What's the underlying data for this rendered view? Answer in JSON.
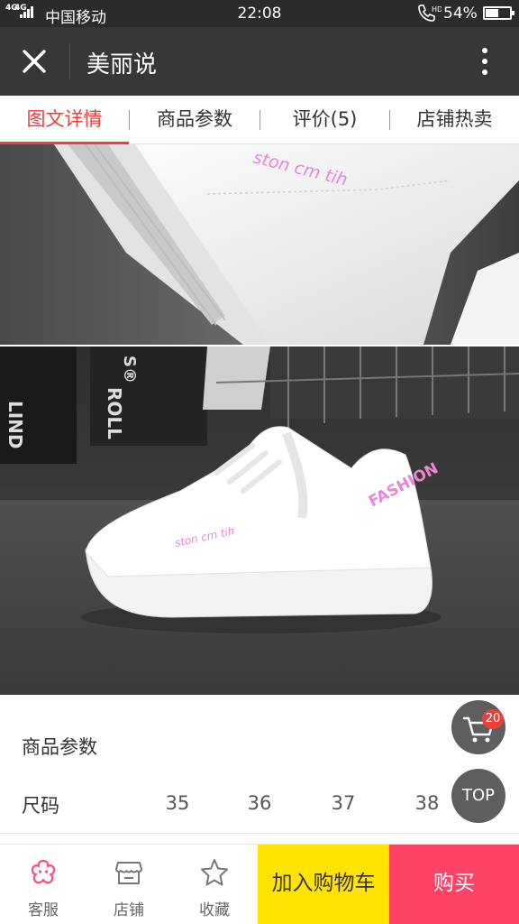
{
  "status_bar": {
    "network": "4G",
    "network2": "4G",
    "carrier": "中国移动",
    "time": "22:08",
    "hd": "HD",
    "battery": "54%",
    "battery_level": 0.54
  },
  "title_bar": {
    "title": "美丽说"
  },
  "tabs": [
    {
      "label": "图文详情",
      "active": true
    },
    {
      "label": "商品参数",
      "active": false
    },
    {
      "label": "评价(5)",
      "active": false
    },
    {
      "label": "店铺热卖",
      "active": false
    }
  ],
  "photos": {
    "shoe_print": "ston cm tih",
    "shoe_heel": "FASHION",
    "bg_text_1": "LIND",
    "bg_text_2": "S®",
    "bg_text_3": "ROLL"
  },
  "params": {
    "title": "商品参数",
    "size_label": "尺码",
    "sizes": [
      "35",
      "36",
      "37",
      "38"
    ]
  },
  "fab": {
    "cart_count": "20",
    "top_label": "TOP"
  },
  "bottom_bar": {
    "service": "客服",
    "shop": "店铺",
    "favorite": "收藏",
    "add_to_cart": "加入购物车",
    "buy": "购买"
  },
  "colors": {
    "accent_red": "#e8413c",
    "cart_yellow": "#ffe400",
    "buy_pink": "#ff4266",
    "shoe_text_pink": "#e986d6"
  }
}
